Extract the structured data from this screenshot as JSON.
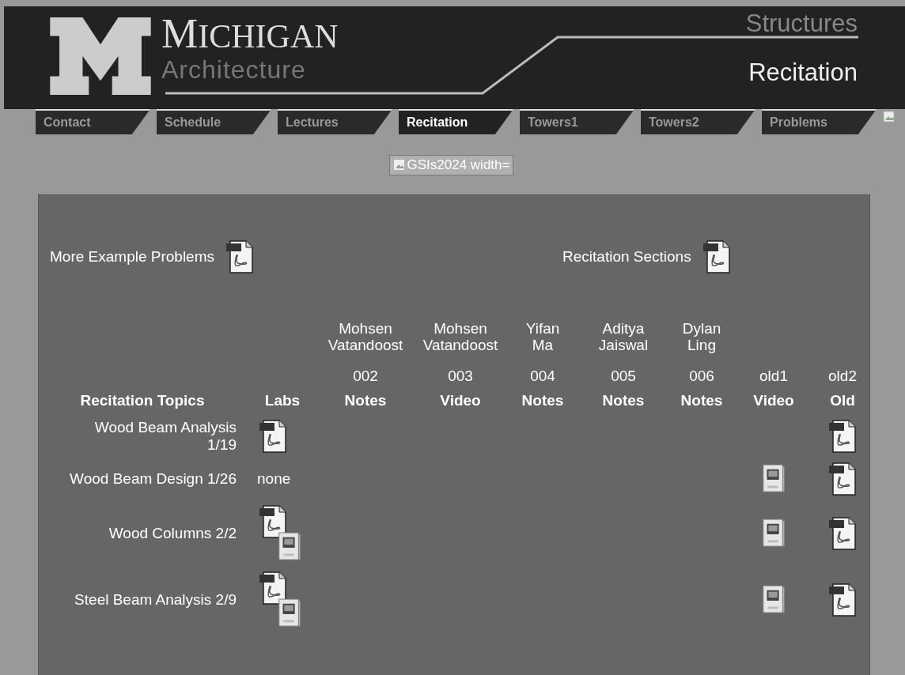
{
  "header": {
    "logo_title": "MICHIGAN",
    "logo_subtitle": "Architecture",
    "course": "Structures",
    "page": "Recitation"
  },
  "tabs": [
    {
      "label": "Contact",
      "selected": false
    },
    {
      "label": "Schedule",
      "selected": false
    },
    {
      "label": "Lectures",
      "selected": false
    },
    {
      "label": "Recitation",
      "selected": true
    },
    {
      "label": "Towers1",
      "selected": false
    },
    {
      "label": "Towers2",
      "selected": false
    },
    {
      "label": "Problems",
      "selected": false
    }
  ],
  "banner_image": {
    "alt": "GSIs2024 width="
  },
  "links": [
    {
      "label": "More Example Problems"
    },
    {
      "label": "Recitation Sections"
    }
  ],
  "table": {
    "columns": [
      {
        "heading": "Recitation Topics"
      },
      {
        "heading": "Labs"
      },
      {
        "instructor": "Mohsen Vatandoost",
        "section": "002",
        "heading": "Notes"
      },
      {
        "instructor": "Mohsen Vatandoost",
        "section": "003",
        "heading": "Video"
      },
      {
        "instructor": "Yifan Ma",
        "section": "004",
        "heading": "Notes"
      },
      {
        "instructor": "Aditya Jaiswal",
        "section": "005",
        "heading": "Notes"
      },
      {
        "instructor": "Dylan Ling",
        "section": "006",
        "heading": "Notes"
      },
      {
        "section": "old1",
        "heading": "Video"
      },
      {
        "section": "old2",
        "heading": "Old"
      }
    ],
    "rows": [
      {
        "cells": [
          {
            "kind": "text",
            "text": "Wood Beam Analysis 1/19"
          },
          {
            "kind": "files",
            "files": [
              {
                "kind": "pdf"
              }
            ]
          },
          {
            "kind": "empty"
          },
          {
            "kind": "empty"
          },
          {
            "kind": "empty"
          },
          {
            "kind": "empty"
          },
          {
            "kind": "empty"
          },
          {
            "kind": "empty"
          },
          {
            "kind": "files",
            "files": [
              {
                "kind": "pdf"
              }
            ]
          }
        ]
      },
      {
        "cells": [
          {
            "kind": "text",
            "text": "Wood Beam Design 1/26"
          },
          {
            "kind": "text",
            "text": "none"
          },
          {
            "kind": "empty"
          },
          {
            "kind": "empty"
          },
          {
            "kind": "empty"
          },
          {
            "kind": "empty"
          },
          {
            "kind": "empty"
          },
          {
            "kind": "files",
            "files": [
              {
                "kind": "mp4"
              }
            ]
          },
          {
            "kind": "files",
            "files": [
              {
                "kind": "pdf"
              }
            ]
          }
        ]
      },
      {
        "cells": [
          {
            "kind": "text",
            "text": "Wood Columns 2/2"
          },
          {
            "kind": "files",
            "files": [
              {
                "kind": "pdf"
              },
              {
                "kind": "mp4"
              }
            ]
          },
          {
            "kind": "empty"
          },
          {
            "kind": "empty"
          },
          {
            "kind": "empty"
          },
          {
            "kind": "empty"
          },
          {
            "kind": "empty"
          },
          {
            "kind": "files",
            "files": [
              {
                "kind": "mp4"
              }
            ]
          },
          {
            "kind": "files",
            "files": [
              {
                "kind": "pdf"
              }
            ]
          }
        ]
      },
      {
        "cells": [
          {
            "kind": "text",
            "text": "Steel Beam Analysis 2/9"
          },
          {
            "kind": "files",
            "files": [
              {
                "kind": "pdf"
              },
              {
                "kind": "mp4"
              }
            ]
          },
          {
            "kind": "empty"
          },
          {
            "kind": "empty"
          },
          {
            "kind": "empty"
          },
          {
            "kind": "empty"
          },
          {
            "kind": "empty"
          },
          {
            "kind": "files",
            "files": [
              {
                "kind": "mp4"
              }
            ]
          },
          {
            "kind": "files",
            "files": [
              {
                "kind": "pdf"
              }
            ]
          }
        ]
      }
    ]
  }
}
